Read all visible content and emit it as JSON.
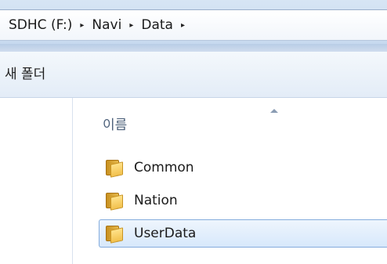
{
  "address_bar": {
    "crumbs": [
      "SDHC (F:)",
      "Navi",
      "Data"
    ],
    "separator": "▸"
  },
  "toolbar": {
    "new_folder_label": "새 폴더"
  },
  "list": {
    "column_name": "이름",
    "items": [
      {
        "name": "Common",
        "icon": "folder-icon",
        "selected": false
      },
      {
        "name": "Nation",
        "icon": "folder-icon",
        "selected": false
      },
      {
        "name": "UserData",
        "icon": "folder-icon",
        "selected": true
      }
    ]
  },
  "colors": {
    "selection_border": "#84acdd",
    "selection_fill": "#d7e8fb",
    "folder": "#f2c14d"
  }
}
